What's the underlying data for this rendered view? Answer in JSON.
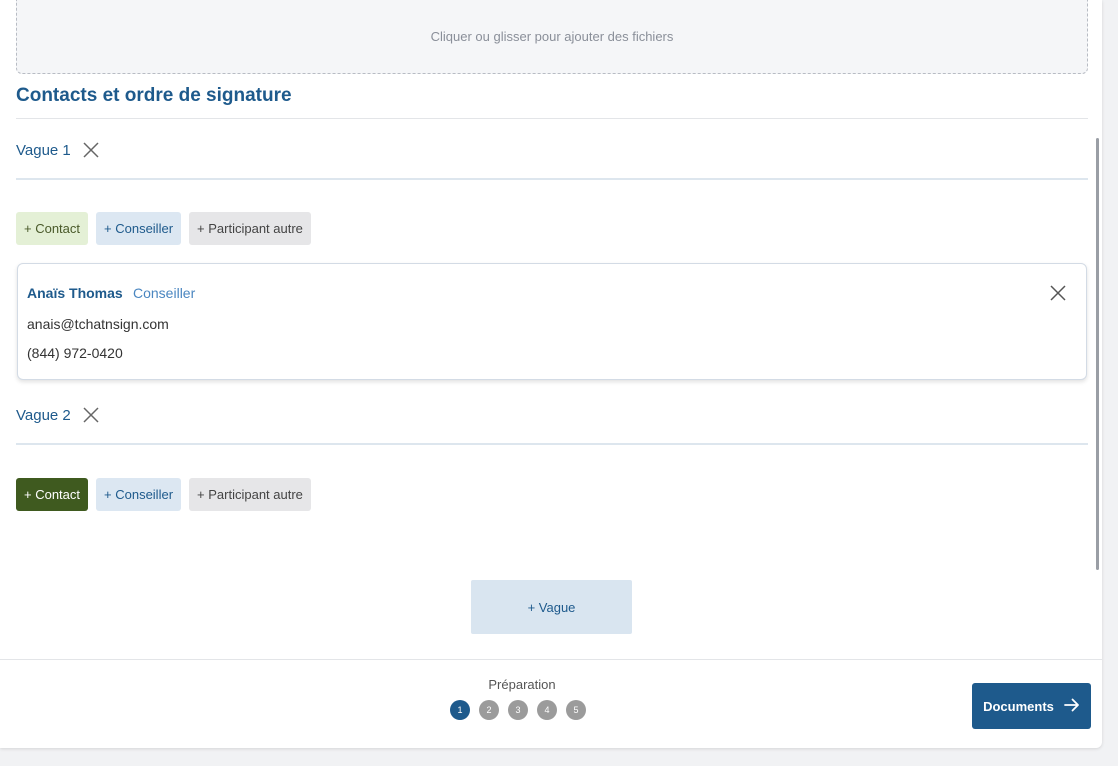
{
  "dropzone": {
    "text": "Cliquer ou glisser pour ajouter des fichiers"
  },
  "section": {
    "title": "Contacts et ordre de signature"
  },
  "waves": [
    {
      "label": "Vague 1",
      "buttons": {
        "contact": "+ Contact",
        "conseiller": "+ Conseiller",
        "autre": "+ Participant autre"
      }
    },
    {
      "label": "Vague 2",
      "buttons": {
        "contact": "+ Contact",
        "conseiller": "+ Conseiller",
        "autre": "+ Participant autre"
      }
    }
  ],
  "participant": {
    "name": "Anaïs Thomas",
    "role": "Conseiller",
    "email": "anais@tchatnsign.com",
    "phone": "(844) 972-0420"
  },
  "add_wave": {
    "label": "+ Vague"
  },
  "stepper": {
    "label": "Préparation",
    "steps": [
      "1",
      "2",
      "3",
      "4",
      "5"
    ],
    "current": 1
  },
  "next_button": {
    "label": "Documents"
  },
  "colors": {
    "primary": "#1e5a8c",
    "contact_active": "#3f5a1f",
    "contact": "#e4f0d6"
  }
}
